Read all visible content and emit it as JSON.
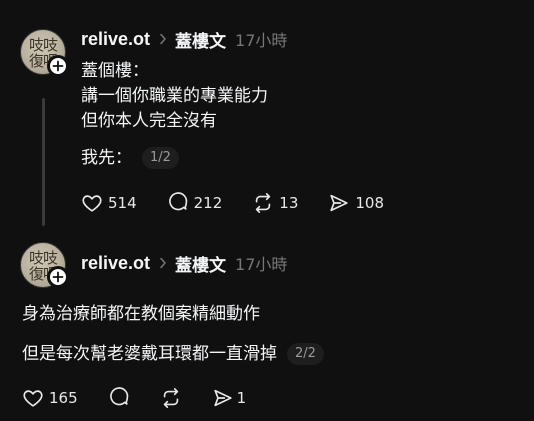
{
  "posts": [
    {
      "username": "relive.ot",
      "topic": "蓋樓文",
      "time": "17小時",
      "lines": [
        "蓋個樓：",
        "講一個你職業的專業能力",
        "但你本人完全沒有"
      ],
      "last_line": "我先：",
      "page_badge": "1/2",
      "stats": {
        "likes": "514",
        "replies": "212",
        "reposts": "13",
        "shares": "108"
      }
    },
    {
      "username": "relive.ot",
      "topic": "蓋樓文",
      "time": "17小時",
      "lines": [
        "身為治療師都在教個案精細動作"
      ],
      "last_line": "但是每次幫老婆戴耳環都一直滑掉",
      "page_badge": "2/2",
      "stats": {
        "likes": "165",
        "replies": "",
        "reposts": "",
        "shares": "1"
      }
    }
  ]
}
